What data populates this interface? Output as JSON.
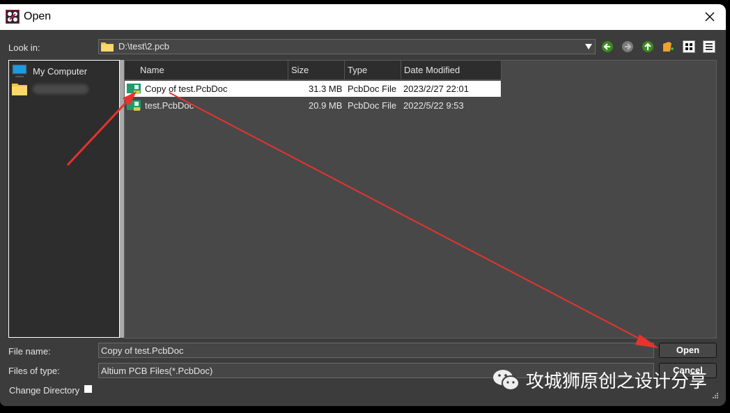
{
  "window": {
    "title": "Open",
    "close_icon": "close-icon",
    "app_icon": "altium-logo-icon"
  },
  "look_in": {
    "label": "Look in:",
    "path": "D:\\test\\2.pcb",
    "toolbar": [
      "back-arrow-icon",
      "forward-arrow-icon",
      "up-folder-icon",
      "new-folder-icon",
      "list-view-icon",
      "details-view-icon"
    ]
  },
  "places": [
    {
      "label": "My Computer",
      "icon": "computer-icon"
    },
    {
      "label": "",
      "icon": "folder-icon",
      "redacted": true
    }
  ],
  "file_list": {
    "columns": [
      "Name",
      "Size",
      "Type",
      "Date Modified"
    ],
    "rows": [
      {
        "name": "Copy of test.PcbDoc",
        "size": "31.3 MB",
        "type": "PcbDoc File",
        "modified": "2023/2/27 22:01",
        "selected": true
      },
      {
        "name": "test.PcbDoc",
        "size": "20.9 MB",
        "type": "PcbDoc File",
        "modified": "2022/5/22 9:53",
        "selected": false
      }
    ]
  },
  "file_name": {
    "label": "File name:",
    "value": "Copy of test.PcbDoc"
  },
  "files_of_type": {
    "label": "Files of type:",
    "value": "Altium PCB Files(*.PcbDoc)"
  },
  "change_directory": {
    "label": "Change Directory",
    "checked": false
  },
  "buttons": {
    "open": "Open",
    "cancel": "Cancel"
  },
  "watermark": {
    "text": "攻城狮原创之设计分享",
    "icon": "wechat-icon"
  },
  "colors": {
    "annotation_arrow": "#e8322e",
    "dialog_bg": "#3c3c3c",
    "list_bg": "#484848"
  }
}
